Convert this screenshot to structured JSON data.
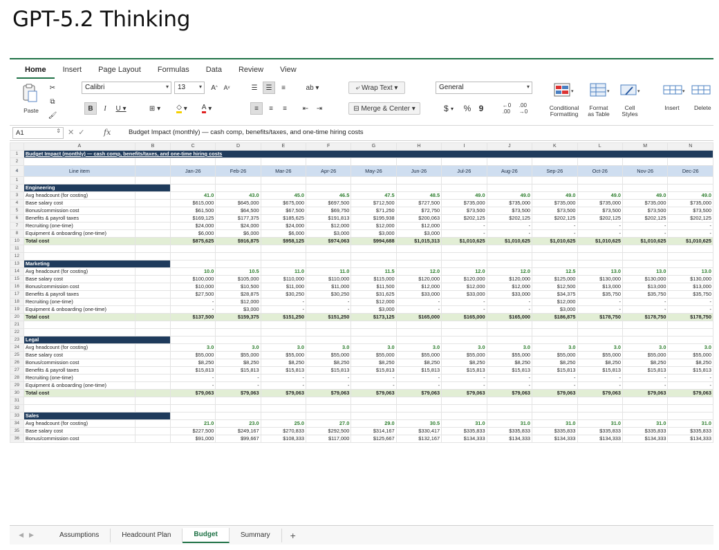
{
  "page_title": "GPT-5.2 Thinking",
  "ribbon": {
    "tabs": [
      "Home",
      "Insert",
      "Page Layout",
      "Formulas",
      "Data",
      "Review",
      "View"
    ],
    "active_tab": "Home",
    "paste_label": "Paste",
    "font_name": "Calibri",
    "font_size": "13",
    "wrap_text": "Wrap Text",
    "merge_center": "Merge & Center",
    "number_format": "General",
    "currency_symbol": "$",
    "percent_symbol": "%",
    "comma_symbol": "9",
    "conditional_formatting": [
      "Conditional",
      "Formatting"
    ],
    "format_as_table": [
      "Format",
      "as Table"
    ],
    "cell_styles": [
      "Cell",
      "Styles"
    ],
    "insert_label": "Insert",
    "delete_label": "Delete",
    "accent_color": "#1e7145"
  },
  "formula_bar": {
    "cell_ref": "A1",
    "fx": "fx",
    "content": "Budget Impact (monthly) — cash comp, benefits/taxes, and one-time hiring costs"
  },
  "grid": {
    "col_letters": [
      "A",
      "B",
      "C",
      "D",
      "E",
      "F",
      "G",
      "H",
      "I",
      "J",
      "K",
      "L",
      "M",
      "N"
    ],
    "title": "Budget Impact (monthly) — cash comp, benefits/taxes, and one-time hiring costs",
    "header_label": "Line item",
    "months": [
      "Jan-26",
      "Feb-26",
      "Mar-26",
      "Apr-26",
      "May-26",
      "Jun-26",
      "Jul-26",
      "Aug-26",
      "Sep-26",
      "Oct-26",
      "Nov-26",
      "Dec-26"
    ],
    "sections": [
      {
        "name": "Engineering",
        "section_row": "2",
        "rows": [
          {
            "rn": "3",
            "label": "Avg headcount (for costing)",
            "values": [
              "41.0",
              "43.0",
              "45.0",
              "46.5",
              "47.5",
              "48.5",
              "49.0",
              "49.0",
              "49.0",
              "49.0",
              "49.0",
              "49.0"
            ]
          },
          {
            "rn": "4",
            "label": "Base salary cost",
            "values": [
              "$615,000",
              "$645,000",
              "$675,000",
              "$697,500",
              "$712,500",
              "$727,500",
              "$735,000",
              "$735,000",
              "$735,000",
              "$735,000",
              "$735,000",
              "$735,000"
            ]
          },
          {
            "rn": "5",
            "label": "Bonus/commission cost",
            "values": [
              "$61,500",
              "$64,500",
              "$67,500",
              "$69,750",
              "$71,250",
              "$72,750",
              "$73,500",
              "$73,500",
              "$73,500",
              "$73,500",
              "$73,500",
              "$73,500"
            ]
          },
          {
            "rn": "6",
            "label": "Benefits & payroll taxes",
            "values": [
              "$169,125",
              "$177,375",
              "$185,625",
              "$191,813",
              "$195,938",
              "$200,063",
              "$202,125",
              "$202,125",
              "$202,125",
              "$202,125",
              "$202,125",
              "$202,125"
            ]
          },
          {
            "rn": "7",
            "label": "Recruiting (one-time)",
            "values": [
              "$24,000",
              "$24,000",
              "$24,000",
              "$12,000",
              "$12,000",
              "$12,000",
              "-",
              "-",
              "-",
              "-",
              "-",
              "-"
            ]
          },
          {
            "rn": "8",
            "label": "Equipment & onboarding (one-time)",
            "values": [
              "$6,000",
              "$6,000",
              "$6,000",
              "$3,000",
              "$3,000",
              "$3,000",
              "-",
              "-",
              "-",
              "-",
              "-",
              "-"
            ]
          },
          {
            "rn": "10",
            "label": "Total cost",
            "values": [
              "$875,625",
              "$916,875",
              "$958,125",
              "$974,063",
              "$994,688",
              "$1,015,313",
              "$1,010,625",
              "$1,010,625",
              "$1,010,625",
              "$1,010,625",
              "$1,010,625",
              "$1,010,625"
            ],
            "total": true
          }
        ]
      },
      {
        "name": "Marketing",
        "section_row": "13",
        "rows": [
          {
            "rn": "14",
            "label": "Avg headcount (for costing)",
            "values": [
              "10.0",
              "10.5",
              "11.0",
              "11.0",
              "11.5",
              "12.0",
              "12.0",
              "12.0",
              "12.5",
              "13.0",
              "13.0",
              "13.0"
            ]
          },
          {
            "rn": "15",
            "label": "Base salary cost",
            "values": [
              "$100,000",
              "$105,000",
              "$110,000",
              "$110,000",
              "$115,000",
              "$120,000",
              "$120,000",
              "$120,000",
              "$125,000",
              "$130,000",
              "$130,000",
              "$130,000"
            ]
          },
          {
            "rn": "16",
            "label": "Bonus/commission cost",
            "values": [
              "$10,000",
              "$10,500",
              "$11,000",
              "$11,000",
              "$11,500",
              "$12,000",
              "$12,000",
              "$12,000",
              "$12,500",
              "$13,000",
              "$13,000",
              "$13,000"
            ]
          },
          {
            "rn": "17",
            "label": "Benefits & payroll taxes",
            "values": [
              "$27,500",
              "$28,875",
              "$30,250",
              "$30,250",
              "$31,625",
              "$33,000",
              "$33,000",
              "$33,000",
              "$34,375",
              "$35,750",
              "$35,750",
              "$35,750"
            ]
          },
          {
            "rn": "18",
            "label": "Recruiting (one-time)",
            "values": [
              "-",
              "$12,000",
              "-",
              "-",
              "$12,000",
              "-",
              "-",
              "-",
              "$12,000",
              "-",
              "-",
              "-"
            ]
          },
          {
            "rn": "19",
            "label": "Equipment & onboarding (one-time)",
            "values": [
              "-",
              "$3,000",
              "-",
              "-",
              "$3,000",
              "-",
              "-",
              "-",
              "$3,000",
              "-",
              "-",
              "-"
            ]
          },
          {
            "rn": "20",
            "label": "Total cost",
            "values": [
              "$137,500",
              "$159,375",
              "$151,250",
              "$151,250",
              "$173,125",
              "$165,000",
              "$165,000",
              "$165,000",
              "$186,875",
              "$178,750",
              "$178,750",
              "$178,750"
            ],
            "total": true
          }
        ]
      },
      {
        "name": "Legal",
        "section_row": "23",
        "rows": [
          {
            "rn": "24",
            "label": "Avg headcount (for costing)",
            "values": [
              "3.0",
              "3.0",
              "3.0",
              "3.0",
              "3.0",
              "3.0",
              "3.0",
              "3.0",
              "3.0",
              "3.0",
              "3.0",
              "3.0"
            ]
          },
          {
            "rn": "25",
            "label": "Base salary cost",
            "values": [
              "$55,000",
              "$55,000",
              "$55,000",
              "$55,000",
              "$55,000",
              "$55,000",
              "$55,000",
              "$55,000",
              "$55,000",
              "$55,000",
              "$55,000",
              "$55,000"
            ]
          },
          {
            "rn": "26",
            "label": "Bonus/commission cost",
            "values": [
              "$8,250",
              "$8,250",
              "$8,250",
              "$8,250",
              "$8,250",
              "$8,250",
              "$8,250",
              "$8,250",
              "$8,250",
              "$8,250",
              "$8,250",
              "$8,250"
            ]
          },
          {
            "rn": "27",
            "label": "Benefits & payroll taxes",
            "values": [
              "$15,813",
              "$15,813",
              "$15,813",
              "$15,813",
              "$15,813",
              "$15,813",
              "$15,813",
              "$15,813",
              "$15,813",
              "$15,813",
              "$15,813",
              "$15,813"
            ]
          },
          {
            "rn": "28",
            "label": "Recruiting (one-time)",
            "values": [
              "-",
              "-",
              "-",
              "-",
              "-",
              "-",
              "-",
              "-",
              "-",
              "-",
              "-",
              "-"
            ]
          },
          {
            "rn": "29",
            "label": "Equipment & onboarding (one-time)",
            "values": [
              "-",
              "-",
              "-",
              "-",
              "-",
              "-",
              "-",
              "-",
              "-",
              "-",
              "-",
              "-"
            ]
          },
          {
            "rn": "30",
            "label": "Total cost",
            "values": [
              "$79,063",
              "$79,063",
              "$79,063",
              "$79,063",
              "$79,063",
              "$79,063",
              "$79,063",
              "$79,063",
              "$79,063",
              "$79,063",
              "$79,063",
              "$79,063"
            ],
            "total": true
          }
        ]
      },
      {
        "name": "Sales",
        "section_row": "33",
        "rows": [
          {
            "rn": "34",
            "label": "Avg headcount (for costing)",
            "values": [
              "21.0",
              "23.0",
              "25.0",
              "27.0",
              "29.0",
              "30.5",
              "31.0",
              "31.0",
              "31.0",
              "31.0",
              "31.0",
              "31.0"
            ]
          },
          {
            "rn": "35",
            "label": "Base salary cost",
            "values": [
              "$227,500",
              "$249,167",
              "$270,833",
              "$292,500",
              "$314,167",
              "$330,417",
              "$335,833",
              "$335,833",
              "$335,833",
              "$335,833",
              "$335,833",
              "$335,833"
            ]
          },
          {
            "rn": "36",
            "label": "Bonus/commission cost",
            "values": [
              "$91,000",
              "$99,667",
              "$108,333",
              "$117,000",
              "$125,667",
              "$132,167",
              "$134,333",
              "$134,333",
              "$134,333",
              "$134,333",
              "$134,333",
              "$134,333"
            ]
          }
        ]
      }
    ]
  },
  "sheet_tabs": [
    "Assumptions",
    "Headcount Plan",
    "Budget",
    "Summary"
  ],
  "active_sheet": "Budget",
  "add_sheet": "+"
}
